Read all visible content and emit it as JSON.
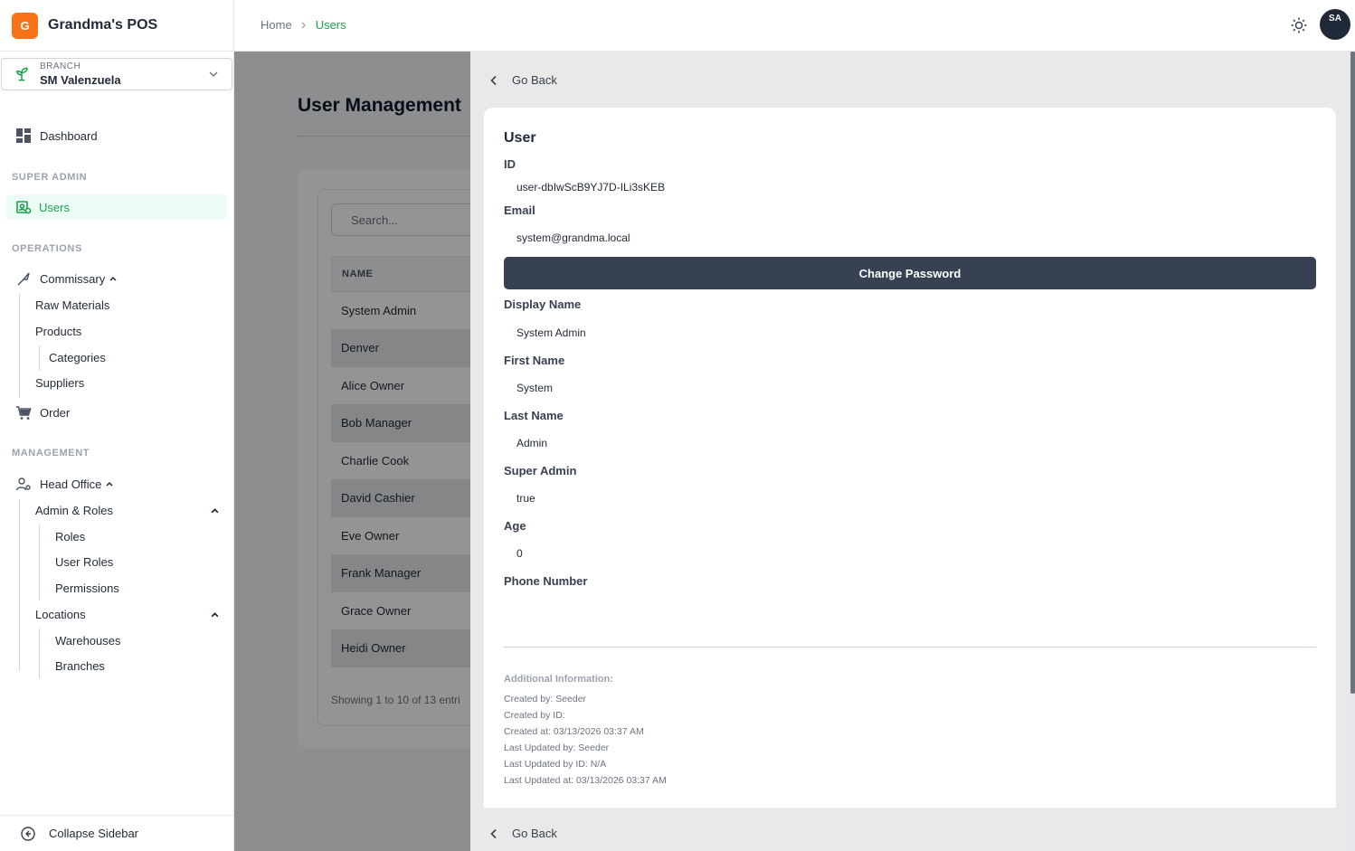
{
  "app": {
    "logo_letter": "G",
    "name": "Grandma's POS"
  },
  "branch": {
    "label": "BRANCH",
    "value": "SM Valenzuela"
  },
  "sidebar": {
    "dashboard": "Dashboard",
    "section_super_admin": "SUPER ADMIN",
    "users": "Users",
    "section_operations": "OPERATIONS",
    "commissary": "Commissary",
    "raw_materials": "Raw Materials",
    "products": "Products",
    "categories": "Categories",
    "suppliers": "Suppliers",
    "order": "Order",
    "section_management": "MANAGEMENT",
    "head_office": "Head Office",
    "admin_roles": "Admin & Roles",
    "roles": "Roles",
    "user_roles": "User Roles",
    "permissions": "Permissions",
    "locations": "Locations",
    "warehouses": "Warehouses",
    "branches": "Branches",
    "collapse": "Collapse Sidebar"
  },
  "breadcrumb": {
    "home": "Home",
    "current": "Users"
  },
  "user_avatar": "SA",
  "main": {
    "title": "User Management",
    "search_placeholder": "Search...",
    "column_name": "NAME",
    "rows": [
      "System Admin",
      "Denver",
      "Alice Owner",
      "Bob Manager",
      "Charlie Cook",
      "David Cashier",
      "Eve Owner",
      "Frank Manager",
      "Grace Owner",
      "Heidi Owner"
    ],
    "showing": "Showing 1 to 10 of 13 entri"
  },
  "drawer": {
    "go_back": "Go Back",
    "heading": "User",
    "id_label": "ID",
    "id_value": "user-dbIwScB9YJ7D-ILi3sKEB",
    "email_label": "Email",
    "email_value": "system@grandma.local",
    "change_password": "Change Password",
    "display_name_label": "Display Name",
    "display_name_value": "System Admin",
    "first_name_label": "First Name",
    "first_name_value": "System",
    "last_name_label": "Last Name",
    "last_name_value": "Admin",
    "super_admin_label": "Super Admin",
    "super_admin_value": "true",
    "age_label": "Age",
    "age_value": "0",
    "phone_label": "Phone Number",
    "phone_value": "",
    "additional_title": "Additional Information:",
    "created_by": "Created by: Seeder",
    "created_by_id": "Created by ID:",
    "created_at": "Created at: 03/13/2026 03:37 AM",
    "updated_by": "Last Updated by: Seeder",
    "updated_by_id": "Last Updated by ID: N/A",
    "updated_at": "Last Updated at: 03/13/2026 03:37 AM"
  },
  "colors": {
    "accent": "#16a34a",
    "brand": "#f97316",
    "primary_button": "#374151"
  }
}
